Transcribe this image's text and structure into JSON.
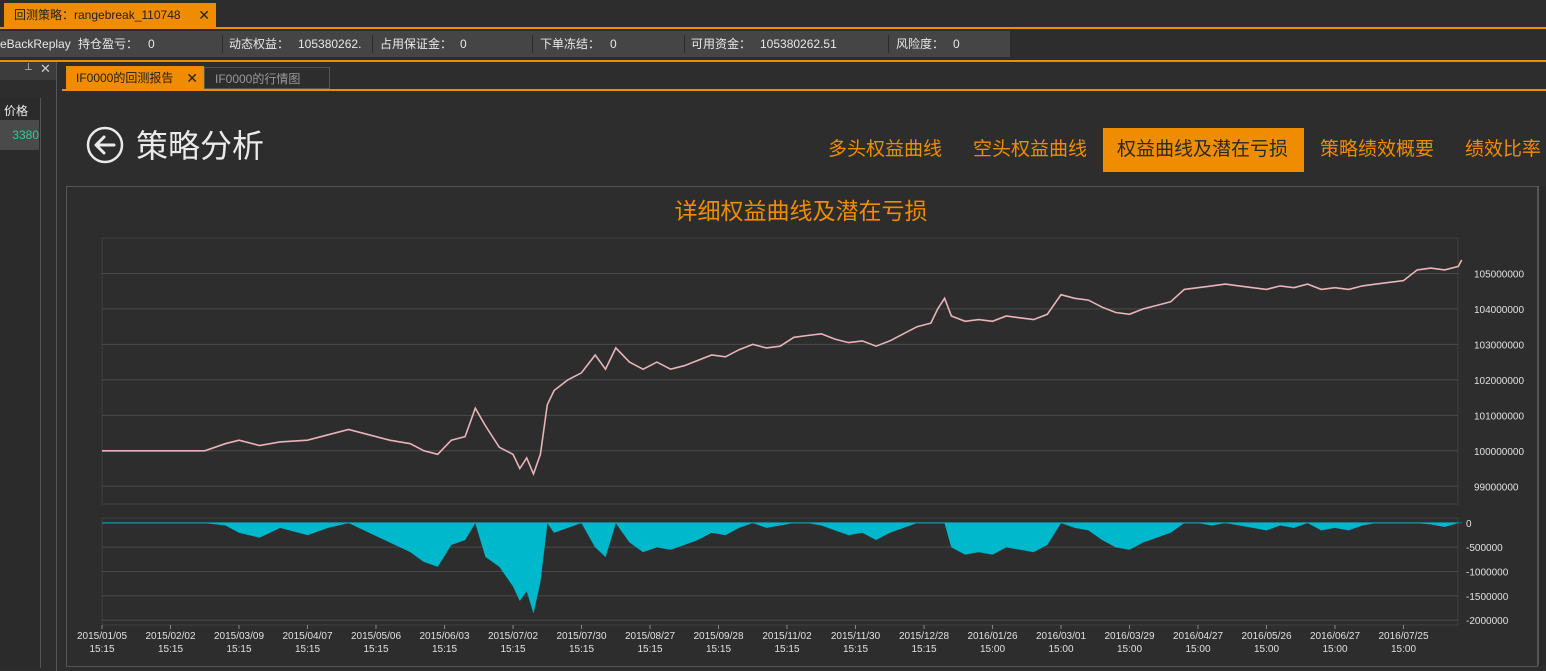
{
  "top_tab": {
    "label": "回测策略：rangebreak_110748",
    "close": "✕"
  },
  "status": [
    {
      "label": "eBackReplay",
      "value": ""
    },
    {
      "label": "持仓盈亏：",
      "value": "0"
    },
    {
      "label": "动态权益：",
      "value": "105380262."
    },
    {
      "label": "占用保证金：",
      "value": "0"
    },
    {
      "label": "下单冻结：",
      "value": "0"
    },
    {
      "label": "可用资金：",
      "value": "105380262.51"
    },
    {
      "label": "风险度：",
      "value": "0"
    }
  ],
  "left_panel": {
    "pin": "⊥",
    "close": "✕",
    "column_header": "价格",
    "value": "3380"
  },
  "content_tabs": [
    {
      "label": "IF0000的回测报告",
      "close": "✕",
      "active": true
    },
    {
      "label": "IF0000的行情图",
      "active": false
    }
  ],
  "header": {
    "title": "策略分析"
  },
  "nav": [
    {
      "label": "多头权益曲线",
      "active": false
    },
    {
      "label": "空头权益曲线",
      "active": false
    },
    {
      "label": "权益曲线及潜在亏损",
      "active": true
    },
    {
      "label": "策略绩效概要",
      "active": false
    },
    {
      "label": "绩效比率",
      "active": false
    }
  ],
  "colors": {
    "accent": "#f08c00",
    "equity_line": "#e8b4b8",
    "drawdown_fill": "#00b8cc",
    "background": "#2d2d2d"
  },
  "chart_data": {
    "type": "line",
    "title": "详细权益曲线及潜在亏损",
    "x_ticks": [
      [
        "2015/01/05",
        "15:15"
      ],
      [
        "2015/02/02",
        "15:15"
      ],
      [
        "2015/03/09",
        "15:15"
      ],
      [
        "2015/04/07",
        "15:15"
      ],
      [
        "2015/05/06",
        "15:15"
      ],
      [
        "2015/06/03",
        "15:15"
      ],
      [
        "2015/07/02",
        "15:15"
      ],
      [
        "2015/07/30",
        "15:15"
      ],
      [
        "2015/08/27",
        "15:15"
      ],
      [
        "2015/09/28",
        "15:15"
      ],
      [
        "2015/11/02",
        "15:15"
      ],
      [
        "2015/11/30",
        "15:15"
      ],
      [
        "2015/12/28",
        "15:15"
      ],
      [
        "2016/01/26",
        "15:00"
      ],
      [
        "2016/03/01",
        "15:00"
      ],
      [
        "2016/03/29",
        "15:00"
      ],
      [
        "2016/04/27",
        "15:00"
      ],
      [
        "2016/05/26",
        "15:00"
      ],
      [
        "2016/06/27",
        "15:00"
      ],
      [
        "2016/07/25",
        "15:00"
      ]
    ],
    "equity": {
      "y_ticks": [
        "105000000",
        "104000000",
        "103000000",
        "102000000",
        "101000000",
        "100000000",
        "99000000"
      ],
      "ylim": [
        98500000,
        106000000
      ],
      "points": [
        [
          0,
          100000000
        ],
        [
          1,
          100000000
        ],
        [
          1.5,
          100000000
        ],
        [
          1.8,
          100200000
        ],
        [
          2.0,
          100300000
        ],
        [
          2.3,
          100150000
        ],
        [
          2.6,
          100250000
        ],
        [
          3.0,
          100300000
        ],
        [
          3.3,
          100450000
        ],
        [
          3.6,
          100600000
        ],
        [
          3.9,
          100450000
        ],
        [
          4.2,
          100300000
        ],
        [
          4.5,
          100200000
        ],
        [
          4.7,
          100000000
        ],
        [
          4.9,
          99900000
        ],
        [
          5.1,
          100300000
        ],
        [
          5.3,
          100400000
        ],
        [
          5.45,
          101200000
        ],
        [
          5.6,
          100700000
        ],
        [
          5.8,
          100100000
        ],
        [
          6.0,
          99900000
        ],
        [
          6.1,
          99500000
        ],
        [
          6.2,
          99800000
        ],
        [
          6.3,
          99350000
        ],
        [
          6.4,
          99900000
        ],
        [
          6.5,
          101300000
        ],
        [
          6.6,
          101700000
        ],
        [
          6.8,
          102000000
        ],
        [
          7.0,
          102200000
        ],
        [
          7.2,
          102700000
        ],
        [
          7.35,
          102300000
        ],
        [
          7.5,
          102900000
        ],
        [
          7.7,
          102500000
        ],
        [
          7.9,
          102300000
        ],
        [
          8.1,
          102500000
        ],
        [
          8.3,
          102300000
        ],
        [
          8.5,
          102400000
        ],
        [
          8.7,
          102550000
        ],
        [
          8.9,
          102700000
        ],
        [
          9.1,
          102650000
        ],
        [
          9.3,
          102850000
        ],
        [
          9.5,
          103000000
        ],
        [
          9.7,
          102900000
        ],
        [
          9.9,
          102950000
        ],
        [
          10.1,
          103200000
        ],
        [
          10.3,
          103250000
        ],
        [
          10.5,
          103300000
        ],
        [
          10.7,
          103150000
        ],
        [
          10.9,
          103050000
        ],
        [
          11.1,
          103100000
        ],
        [
          11.3,
          102950000
        ],
        [
          11.5,
          103100000
        ],
        [
          11.7,
          103300000
        ],
        [
          11.9,
          103500000
        ],
        [
          12.1,
          103600000
        ],
        [
          12.2,
          104000000
        ],
        [
          12.3,
          104300000
        ],
        [
          12.4,
          103800000
        ],
        [
          12.6,
          103650000
        ],
        [
          12.8,
          103700000
        ],
        [
          13.0,
          103650000
        ],
        [
          13.2,
          103800000
        ],
        [
          13.4,
          103750000
        ],
        [
          13.6,
          103700000
        ],
        [
          13.8,
          103850000
        ],
        [
          14.0,
          104400000
        ],
        [
          14.2,
          104300000
        ],
        [
          14.4,
          104250000
        ],
        [
          14.6,
          104050000
        ],
        [
          14.8,
          103900000
        ],
        [
          15.0,
          103850000
        ],
        [
          15.2,
          104000000
        ],
        [
          15.4,
          104100000
        ],
        [
          15.6,
          104200000
        ],
        [
          15.8,
          104550000
        ],
        [
          16.0,
          104600000
        ],
        [
          16.2,
          104650000
        ],
        [
          16.4,
          104700000
        ],
        [
          16.6,
          104650000
        ],
        [
          16.8,
          104600000
        ],
        [
          17.0,
          104550000
        ],
        [
          17.2,
          104650000
        ],
        [
          17.4,
          104600000
        ],
        [
          17.6,
          104700000
        ],
        [
          17.8,
          104550000
        ],
        [
          18.0,
          104600000
        ],
        [
          18.2,
          104550000
        ],
        [
          18.4,
          104650000
        ],
        [
          18.6,
          104700000
        ],
        [
          18.8,
          104750000
        ],
        [
          19.0,
          104800000
        ],
        [
          19.2,
          105100000
        ],
        [
          19.4,
          105150000
        ],
        [
          19.6,
          105100000
        ],
        [
          19.8,
          105200000
        ],
        [
          19.85,
          105380000
        ]
      ]
    },
    "drawdown": {
      "y_ticks": [
        "0",
        "-500000",
        "-1000000",
        "-1500000",
        "-2000000"
      ],
      "ylim": [
        -2100000,
        100000
      ],
      "points": [
        [
          0,
          0
        ],
        [
          1.5,
          0
        ],
        [
          1.8,
          -50000
        ],
        [
          2.0,
          -200000
        ],
        [
          2.3,
          -300000
        ],
        [
          2.6,
          -100000
        ],
        [
          3.0,
          -250000
        ],
        [
          3.3,
          -100000
        ],
        [
          3.6,
          0
        ],
        [
          3.9,
          -200000
        ],
        [
          4.2,
          -400000
        ],
        [
          4.5,
          -600000
        ],
        [
          4.7,
          -800000
        ],
        [
          4.9,
          -900000
        ],
        [
          5.1,
          -450000
        ],
        [
          5.3,
          -350000
        ],
        [
          5.45,
          0
        ],
        [
          5.6,
          -700000
        ],
        [
          5.8,
          -900000
        ],
        [
          6.0,
          -1300000
        ],
        [
          6.1,
          -1600000
        ],
        [
          6.2,
          -1400000
        ],
        [
          6.3,
          -1850000
        ],
        [
          6.4,
          -1200000
        ],
        [
          6.5,
          0
        ],
        [
          6.6,
          -200000
        ],
        [
          6.8,
          -100000
        ],
        [
          7.0,
          0
        ],
        [
          7.2,
          -500000
        ],
        [
          7.35,
          -700000
        ],
        [
          7.5,
          0
        ],
        [
          7.7,
          -400000
        ],
        [
          7.9,
          -600000
        ],
        [
          8.1,
          -500000
        ],
        [
          8.3,
          -550000
        ],
        [
          8.5,
          -450000
        ],
        [
          8.7,
          -350000
        ],
        [
          8.9,
          -200000
        ],
        [
          9.1,
          -250000
        ],
        [
          9.3,
          -100000
        ],
        [
          9.5,
          0
        ],
        [
          9.7,
          -100000
        ],
        [
          9.9,
          -50000
        ],
        [
          10.1,
          0
        ],
        [
          10.3,
          0
        ],
        [
          10.5,
          -50000
        ],
        [
          10.7,
          -150000
        ],
        [
          10.9,
          -250000
        ],
        [
          11.1,
          -200000
        ],
        [
          11.3,
          -350000
        ],
        [
          11.5,
          -200000
        ],
        [
          11.7,
          -100000
        ],
        [
          11.9,
          0
        ],
        [
          12.1,
          0
        ],
        [
          12.2,
          0
        ],
        [
          12.3,
          0
        ],
        [
          12.4,
          -500000
        ],
        [
          12.6,
          -650000
        ],
        [
          12.8,
          -600000
        ],
        [
          13.0,
          -650000
        ],
        [
          13.2,
          -500000
        ],
        [
          13.4,
          -550000
        ],
        [
          13.6,
          -600000
        ],
        [
          13.8,
          -450000
        ],
        [
          14.0,
          0
        ],
        [
          14.2,
          -100000
        ],
        [
          14.4,
          -150000
        ],
        [
          14.6,
          -350000
        ],
        [
          14.8,
          -500000
        ],
        [
          15.0,
          -550000
        ],
        [
          15.2,
          -400000
        ],
        [
          15.4,
          -300000
        ],
        [
          15.6,
          -200000
        ],
        [
          15.8,
          0
        ],
        [
          16.0,
          0
        ],
        [
          16.2,
          -50000
        ],
        [
          16.4,
          0
        ],
        [
          16.6,
          -50000
        ],
        [
          16.8,
          -100000
        ],
        [
          17.0,
          -150000
        ],
        [
          17.2,
          -50000
        ],
        [
          17.4,
          -100000
        ],
        [
          17.6,
          0
        ],
        [
          17.8,
          -150000
        ],
        [
          18.0,
          -100000
        ],
        [
          18.2,
          -150000
        ],
        [
          18.4,
          -50000
        ],
        [
          18.6,
          0
        ],
        [
          18.8,
          0
        ],
        [
          19.0,
          0
        ],
        [
          19.2,
          0
        ],
        [
          19.4,
          -30000
        ],
        [
          19.6,
          -80000
        ],
        [
          19.8,
          0
        ],
        [
          19.85,
          0
        ]
      ]
    }
  }
}
